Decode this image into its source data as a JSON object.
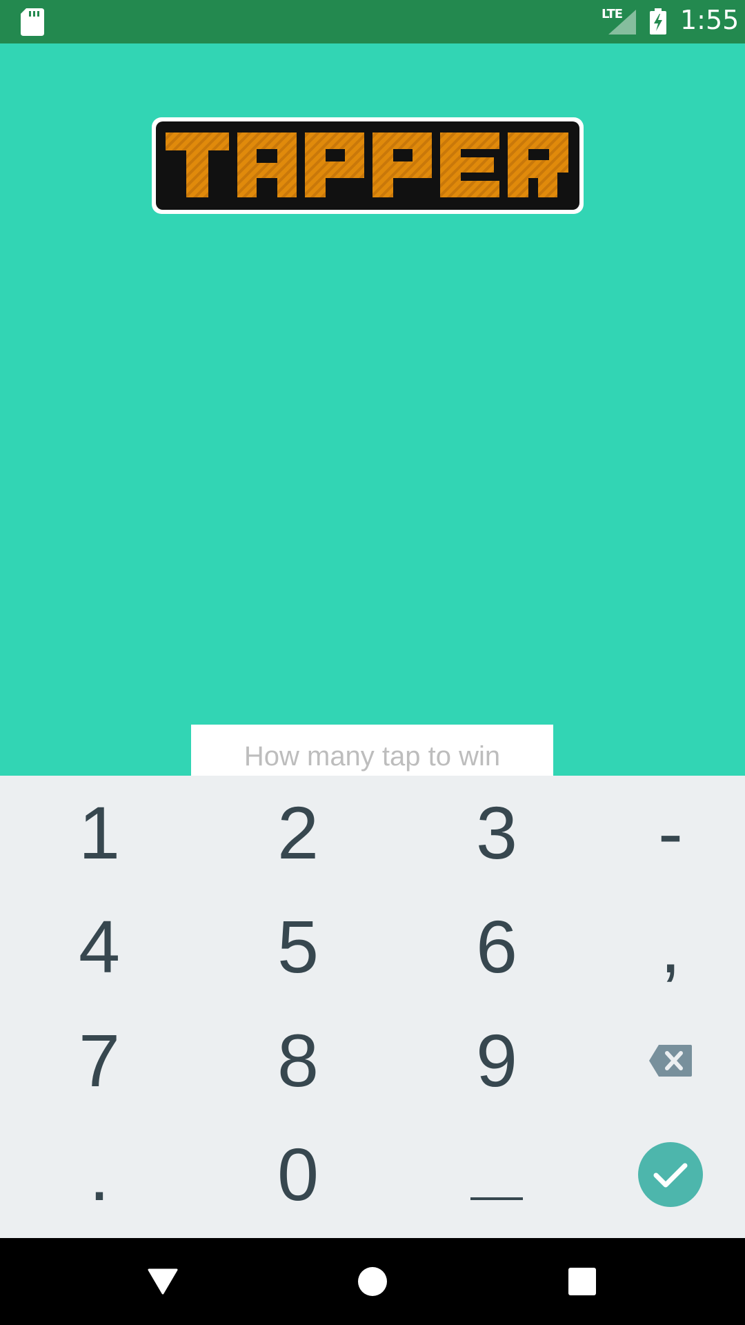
{
  "status_bar": {
    "time": "1:55",
    "network": "LTE",
    "icons": [
      "sd-card-icon",
      "signal-icon",
      "battery-charging-icon"
    ]
  },
  "app": {
    "logo_text": "TAPPER",
    "colors": {
      "background": "#32d5b4",
      "status_bar": "#23894f",
      "logo_fill": "#e08a0b",
      "logo_outline": "#111111"
    }
  },
  "input": {
    "placeholder": "How many tap to win",
    "value": ""
  },
  "keyboard": {
    "rows": [
      [
        "1",
        "2",
        "3",
        "-"
      ],
      [
        "4",
        "5",
        "6",
        ","
      ],
      [
        "7",
        "8",
        "9",
        "backspace-icon"
      ],
      [
        ".",
        "0",
        "space-icon",
        "done-check-icon"
      ]
    ],
    "colors": {
      "background": "#eceff1",
      "text": "#37474f",
      "done": "#4db6ac"
    },
    "labels": {
      "k1": "1",
      "k2": "2",
      "k3": "3",
      "dash": "-",
      "k4": "4",
      "k5": "5",
      "k6": "6",
      "comma": ",",
      "k7": "7",
      "k8": "8",
      "k9": "9",
      "dot": ".",
      "k0": "0"
    }
  },
  "nav_bar": {
    "buttons": [
      "back-icon",
      "home-icon",
      "recents-icon"
    ]
  }
}
